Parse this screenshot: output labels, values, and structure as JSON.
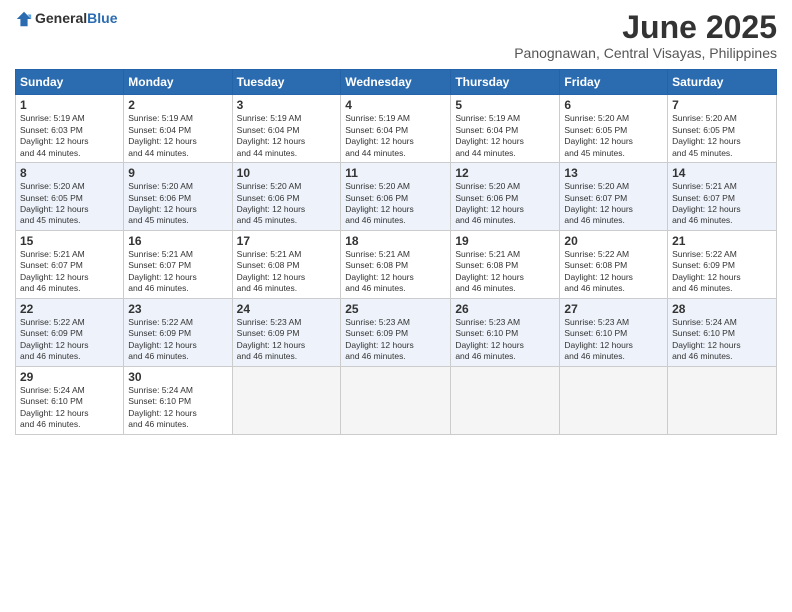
{
  "logo": {
    "general": "General",
    "blue": "Blue"
  },
  "title": "June 2025",
  "location": "Panognawan, Central Visayas, Philippines",
  "weekdays": [
    "Sunday",
    "Monday",
    "Tuesday",
    "Wednesday",
    "Thursday",
    "Friday",
    "Saturday"
  ],
  "weeks": [
    [
      {
        "day": "1",
        "info": "Sunrise: 5:19 AM\nSunset: 6:03 PM\nDaylight: 12 hours\nand 44 minutes."
      },
      {
        "day": "2",
        "info": "Sunrise: 5:19 AM\nSunset: 6:04 PM\nDaylight: 12 hours\nand 44 minutes."
      },
      {
        "day": "3",
        "info": "Sunrise: 5:19 AM\nSunset: 6:04 PM\nDaylight: 12 hours\nand 44 minutes."
      },
      {
        "day": "4",
        "info": "Sunrise: 5:19 AM\nSunset: 6:04 PM\nDaylight: 12 hours\nand 44 minutes."
      },
      {
        "day": "5",
        "info": "Sunrise: 5:19 AM\nSunset: 6:04 PM\nDaylight: 12 hours\nand 44 minutes."
      },
      {
        "day": "6",
        "info": "Sunrise: 5:20 AM\nSunset: 6:05 PM\nDaylight: 12 hours\nand 45 minutes."
      },
      {
        "day": "7",
        "info": "Sunrise: 5:20 AM\nSunset: 6:05 PM\nDaylight: 12 hours\nand 45 minutes."
      }
    ],
    [
      {
        "day": "8",
        "info": "Sunrise: 5:20 AM\nSunset: 6:05 PM\nDaylight: 12 hours\nand 45 minutes."
      },
      {
        "day": "9",
        "info": "Sunrise: 5:20 AM\nSunset: 6:06 PM\nDaylight: 12 hours\nand 45 minutes."
      },
      {
        "day": "10",
        "info": "Sunrise: 5:20 AM\nSunset: 6:06 PM\nDaylight: 12 hours\nand 45 minutes."
      },
      {
        "day": "11",
        "info": "Sunrise: 5:20 AM\nSunset: 6:06 PM\nDaylight: 12 hours\nand 46 minutes."
      },
      {
        "day": "12",
        "info": "Sunrise: 5:20 AM\nSunset: 6:06 PM\nDaylight: 12 hours\nand 46 minutes."
      },
      {
        "day": "13",
        "info": "Sunrise: 5:20 AM\nSunset: 6:07 PM\nDaylight: 12 hours\nand 46 minutes."
      },
      {
        "day": "14",
        "info": "Sunrise: 5:21 AM\nSunset: 6:07 PM\nDaylight: 12 hours\nand 46 minutes."
      }
    ],
    [
      {
        "day": "15",
        "info": "Sunrise: 5:21 AM\nSunset: 6:07 PM\nDaylight: 12 hours\nand 46 minutes."
      },
      {
        "day": "16",
        "info": "Sunrise: 5:21 AM\nSunset: 6:07 PM\nDaylight: 12 hours\nand 46 minutes."
      },
      {
        "day": "17",
        "info": "Sunrise: 5:21 AM\nSunset: 6:08 PM\nDaylight: 12 hours\nand 46 minutes."
      },
      {
        "day": "18",
        "info": "Sunrise: 5:21 AM\nSunset: 6:08 PM\nDaylight: 12 hours\nand 46 minutes."
      },
      {
        "day": "19",
        "info": "Sunrise: 5:21 AM\nSunset: 6:08 PM\nDaylight: 12 hours\nand 46 minutes."
      },
      {
        "day": "20",
        "info": "Sunrise: 5:22 AM\nSunset: 6:08 PM\nDaylight: 12 hours\nand 46 minutes."
      },
      {
        "day": "21",
        "info": "Sunrise: 5:22 AM\nSunset: 6:09 PM\nDaylight: 12 hours\nand 46 minutes."
      }
    ],
    [
      {
        "day": "22",
        "info": "Sunrise: 5:22 AM\nSunset: 6:09 PM\nDaylight: 12 hours\nand 46 minutes."
      },
      {
        "day": "23",
        "info": "Sunrise: 5:22 AM\nSunset: 6:09 PM\nDaylight: 12 hours\nand 46 minutes."
      },
      {
        "day": "24",
        "info": "Sunrise: 5:23 AM\nSunset: 6:09 PM\nDaylight: 12 hours\nand 46 minutes."
      },
      {
        "day": "25",
        "info": "Sunrise: 5:23 AM\nSunset: 6:09 PM\nDaylight: 12 hours\nand 46 minutes."
      },
      {
        "day": "26",
        "info": "Sunrise: 5:23 AM\nSunset: 6:10 PM\nDaylight: 12 hours\nand 46 minutes."
      },
      {
        "day": "27",
        "info": "Sunrise: 5:23 AM\nSunset: 6:10 PM\nDaylight: 12 hours\nand 46 minutes."
      },
      {
        "day": "28",
        "info": "Sunrise: 5:24 AM\nSunset: 6:10 PM\nDaylight: 12 hours\nand 46 minutes."
      }
    ],
    [
      {
        "day": "29",
        "info": "Sunrise: 5:24 AM\nSunset: 6:10 PM\nDaylight: 12 hours\nand 46 minutes."
      },
      {
        "day": "30",
        "info": "Sunrise: 5:24 AM\nSunset: 6:10 PM\nDaylight: 12 hours\nand 46 minutes."
      },
      null,
      null,
      null,
      null,
      null
    ]
  ]
}
